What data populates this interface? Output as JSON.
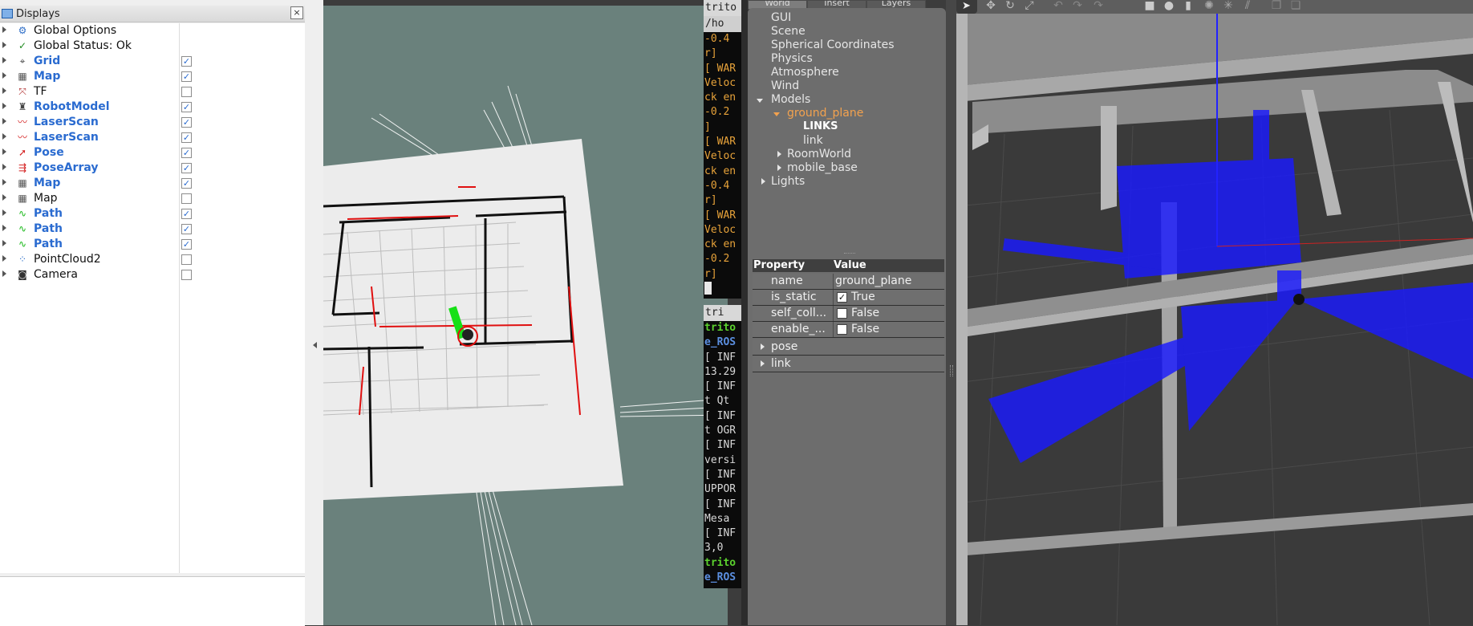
{
  "rviz": {
    "panel_title": "Displays",
    "close_glyph": "×",
    "displays": [
      {
        "label": "Global Options",
        "icon": "gear-icon",
        "glyph": "⚙",
        "color": "#2f6fc8",
        "bold": false,
        "checkbox": null
      },
      {
        "label": "Global Status: Ok",
        "icon": "checkmark-icon",
        "glyph": "✓",
        "color": "#1f8a1f",
        "bold": false,
        "checkbox": null
      },
      {
        "label": "Grid",
        "icon": "grid-icon",
        "glyph": "⌖",
        "color": "#444",
        "bold": true,
        "checkbox": true
      },
      {
        "label": "Map",
        "icon": "map-icon",
        "glyph": "▦",
        "color": "#555",
        "bold": true,
        "checkbox": true
      },
      {
        "label": "TF",
        "icon": "tf-axes-icon",
        "glyph": "⤧",
        "color": "#b03030",
        "bold": false,
        "checkbox": false
      },
      {
        "label": "RobotModel",
        "icon": "robot-model-icon",
        "glyph": "♜",
        "color": "#444",
        "bold": true,
        "checkbox": true
      },
      {
        "label": "LaserScan",
        "icon": "laser-scan-icon",
        "glyph": "〰",
        "color": "#d42020",
        "bold": true,
        "checkbox": true
      },
      {
        "label": "LaserScan",
        "icon": "laser-scan-icon",
        "glyph": "〰",
        "color": "#d42020",
        "bold": true,
        "checkbox": true
      },
      {
        "label": "Pose",
        "icon": "pose-arrow-icon",
        "glyph": "➚",
        "color": "#d42020",
        "bold": true,
        "checkbox": true
      },
      {
        "label": "PoseArray",
        "icon": "pose-array-icon",
        "glyph": "⇶",
        "color": "#d42020",
        "bold": true,
        "checkbox": true
      },
      {
        "label": "Map",
        "icon": "map-icon",
        "glyph": "▦",
        "color": "#555",
        "bold": true,
        "checkbox": true
      },
      {
        "label": "Map",
        "icon": "map-icon",
        "glyph": "▦",
        "color": "#555",
        "bold": false,
        "checkbox": false
      },
      {
        "label": "Path",
        "icon": "path-icon",
        "glyph": "∿",
        "color": "#16b816",
        "bold": true,
        "checkbox": true
      },
      {
        "label": "Path",
        "icon": "path-icon",
        "glyph": "∿",
        "color": "#16b816",
        "bold": true,
        "checkbox": true
      },
      {
        "label": "Path",
        "icon": "path-icon",
        "glyph": "∿",
        "color": "#16b816",
        "bold": true,
        "checkbox": true
      },
      {
        "label": "PointCloud2",
        "icon": "point-cloud-icon",
        "glyph": "⁘",
        "color": "#2f6fc8",
        "bold": false,
        "checkbox": false
      },
      {
        "label": "Camera",
        "icon": "camera-icon",
        "glyph": "◙",
        "color": "#333",
        "bold": false,
        "checkbox": false
      }
    ],
    "checkmark_glyph": "✓"
  },
  "terminals": {
    "top": {
      "tab_title": "trito",
      "tab2_title": "/ho",
      "lines": [
        {
          "text": "-0.4",
          "color": "#e8a33a"
        },
        {
          "text": "r]",
          "color": "#e8a33a"
        },
        {
          "text": "[ WAR",
          "color": "#e8a33a"
        },
        {
          "text": "Veloc",
          "color": "#e8a33a"
        },
        {
          "text": "ck en",
          "color": "#e8a33a"
        },
        {
          "text": "-0.2",
          "color": "#e8a33a"
        },
        {
          "text": "]",
          "color": "#e8a33a"
        },
        {
          "text": "[ WAR",
          "color": "#e8a33a"
        },
        {
          "text": "Veloc",
          "color": "#e8a33a"
        },
        {
          "text": "ck en",
          "color": "#e8a33a"
        },
        {
          "text": "-0.4",
          "color": "#e8a33a"
        },
        {
          "text": "r]",
          "color": "#e8a33a"
        },
        {
          "text": "[ WAR",
          "color": "#e8a33a"
        },
        {
          "text": "Veloc",
          "color": "#e8a33a"
        },
        {
          "text": "ck en",
          "color": "#e8a33a"
        },
        {
          "text": "-0.2",
          "color": "#e8a33a"
        },
        {
          "text": "r]",
          "color": "#e8a33a"
        }
      ]
    },
    "bottom": {
      "tab_title": "tri",
      "lines": [
        {
          "text": "trito",
          "color": "#5bd12e",
          "bold": true
        },
        {
          "text": "e_ROS",
          "color": "#5b8fe0",
          "bold": true
        },
        {
          "text": "[ INF",
          "color": "#d8d8d8"
        },
        {
          "text": "13.29",
          "color": "#d8d8d8"
        },
        {
          "text": "[ INF",
          "color": "#d8d8d8"
        },
        {
          "text": "t Qt",
          "color": "#d8d8d8"
        },
        {
          "text": "[ INF",
          "color": "#d8d8d8"
        },
        {
          "text": "t OGR",
          "color": "#d8d8d8"
        },
        {
          "text": "[ INF",
          "color": "#d8d8d8"
        },
        {
          "text": "versi",
          "color": "#d8d8d8"
        },
        {
          "text": "[ INF",
          "color": "#d8d8d8"
        },
        {
          "text": "UPPOR",
          "color": "#d8d8d8"
        },
        {
          "text": "[ INF",
          "color": "#d8d8d8"
        },
        {
          "text": "Mesa",
          "color": "#d8d8d8"
        },
        {
          "text": "[ INF",
          "color": "#d8d8d8"
        },
        {
          "text": " 3,0",
          "color": "#d8d8d8"
        },
        {
          "text": "trito",
          "color": "#5bd12e",
          "bold": true
        },
        {
          "text": "e_ROS",
          "color": "#5b8fe0",
          "bold": true
        }
      ]
    }
  },
  "gazebo": {
    "tabs": [
      "World",
      "Insert",
      "Layers"
    ],
    "world_tree": {
      "gui": "GUI",
      "scene": "Scene",
      "spherical": "Spherical Coordinates",
      "physics": "Physics",
      "atmosphere": "Atmosphere",
      "wind": "Wind",
      "models": "Models",
      "ground_plane": "ground_plane",
      "links": "LINKS",
      "link": "link",
      "roomworld": "RoomWorld",
      "mobile_base": "mobile_base",
      "lights": "Lights"
    },
    "properties": {
      "header_property": "Property",
      "header_value": "Value",
      "rows": [
        {
          "key": "name",
          "value": "ground_plane",
          "checkbox": null
        },
        {
          "key": "is_static",
          "value": "True",
          "checkbox": true
        },
        {
          "key": "self_coll...",
          "value": "False",
          "checkbox": false
        },
        {
          "key": "enable_...",
          "value": "False",
          "checkbox": false
        }
      ],
      "pose": "pose",
      "link": "link"
    },
    "toolbar_icons": [
      "select-arrow-icon",
      "translate-icon",
      "rotate-icon",
      "scale-icon",
      "undo-icon",
      "redo-icon",
      "box-shape-icon",
      "sphere-shape-icon",
      "cylinder-shape-icon",
      "point-light-icon",
      "spot-light-icon",
      "directional-light-icon",
      "copy-icon",
      "paste-icon"
    ]
  },
  "colors": {
    "rviz_bg": "#6a817c",
    "laser_blue": "#1a1aff",
    "path_green": "#16e016",
    "scan_red": "#e01010",
    "gazebo_floor": "#3a3a3a"
  }
}
